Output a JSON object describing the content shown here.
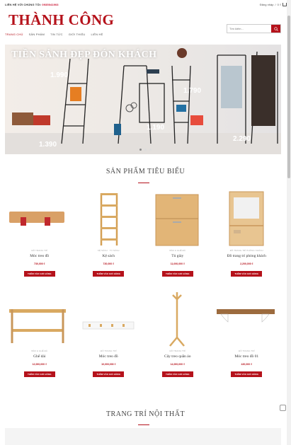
{
  "topbar": {
    "contact_label": "LIÊN HỆ VỚI CHÚNG TÔI:",
    "phone": "0935041903",
    "login": "Đăng nhập",
    "cart": "0 ₫"
  },
  "header": {
    "logo": "THÀNH CÔNG",
    "search_placeholder": "Tìm kiếm..."
  },
  "nav": [
    "TRANG CHỦ",
    "SẢN PHẨM",
    "TIN TỨC",
    "GIỚI THIỆU",
    "LIÊN HỆ"
  ],
  "hero": {
    "title": "TIỀN SẢNH ĐẸP ĐÓN KHÁCH",
    "prices": [
      "1.990",
      "1.790",
      "1.190",
      "1.390",
      "2.290"
    ]
  },
  "featured": {
    "title": "SẢN PHẨM TIÊU BIỂU",
    "add_label": "THÊM VÀO GIỎ HÀNG",
    "products": [
      {
        "cat": "ĐỒ TRANG TRÍ",
        "name": "Móc treo đồ",
        "price": "730,000 ₫"
      },
      {
        "cat": "KỆ SÁCH · TỦ SÁCH",
        "name": "Kệ sách",
        "price": "720,000 ₫"
      },
      {
        "cat": "BÀN & GHẾ ĐÁ",
        "name": "Tủ giày",
        "price": "11,000,000 ₫"
      },
      {
        "cat": "ĐỒ TRANG TRÍ PHÒNG KHÁCH",
        "name": "Đồ trang trí phòng khách",
        "price": "2,200,000 ₫"
      },
      {
        "cat": "BÀN & GHẾ ĐÁ",
        "name": "Ghế dài",
        "price": "12,000,000 ₫"
      },
      {
        "cat": "ĐỒ TRANG TRÍ",
        "name": "Móc treo đồ",
        "price": "10,000,000 ₫"
      },
      {
        "cat": "ĐỒ TRANG TRÍ",
        "name": "Cây treo quần áo",
        "price": "14,000,000 ₫"
      },
      {
        "cat": "ĐỒ TRANG TRÍ",
        "name": "Móc treo đồ 01",
        "price": "420,000 ₫"
      }
    ]
  },
  "decor": {
    "title": "TRANG TRÍ NỘI THẤT"
  },
  "colors": {
    "brand": "#b5121b",
    "text": "#333333"
  }
}
